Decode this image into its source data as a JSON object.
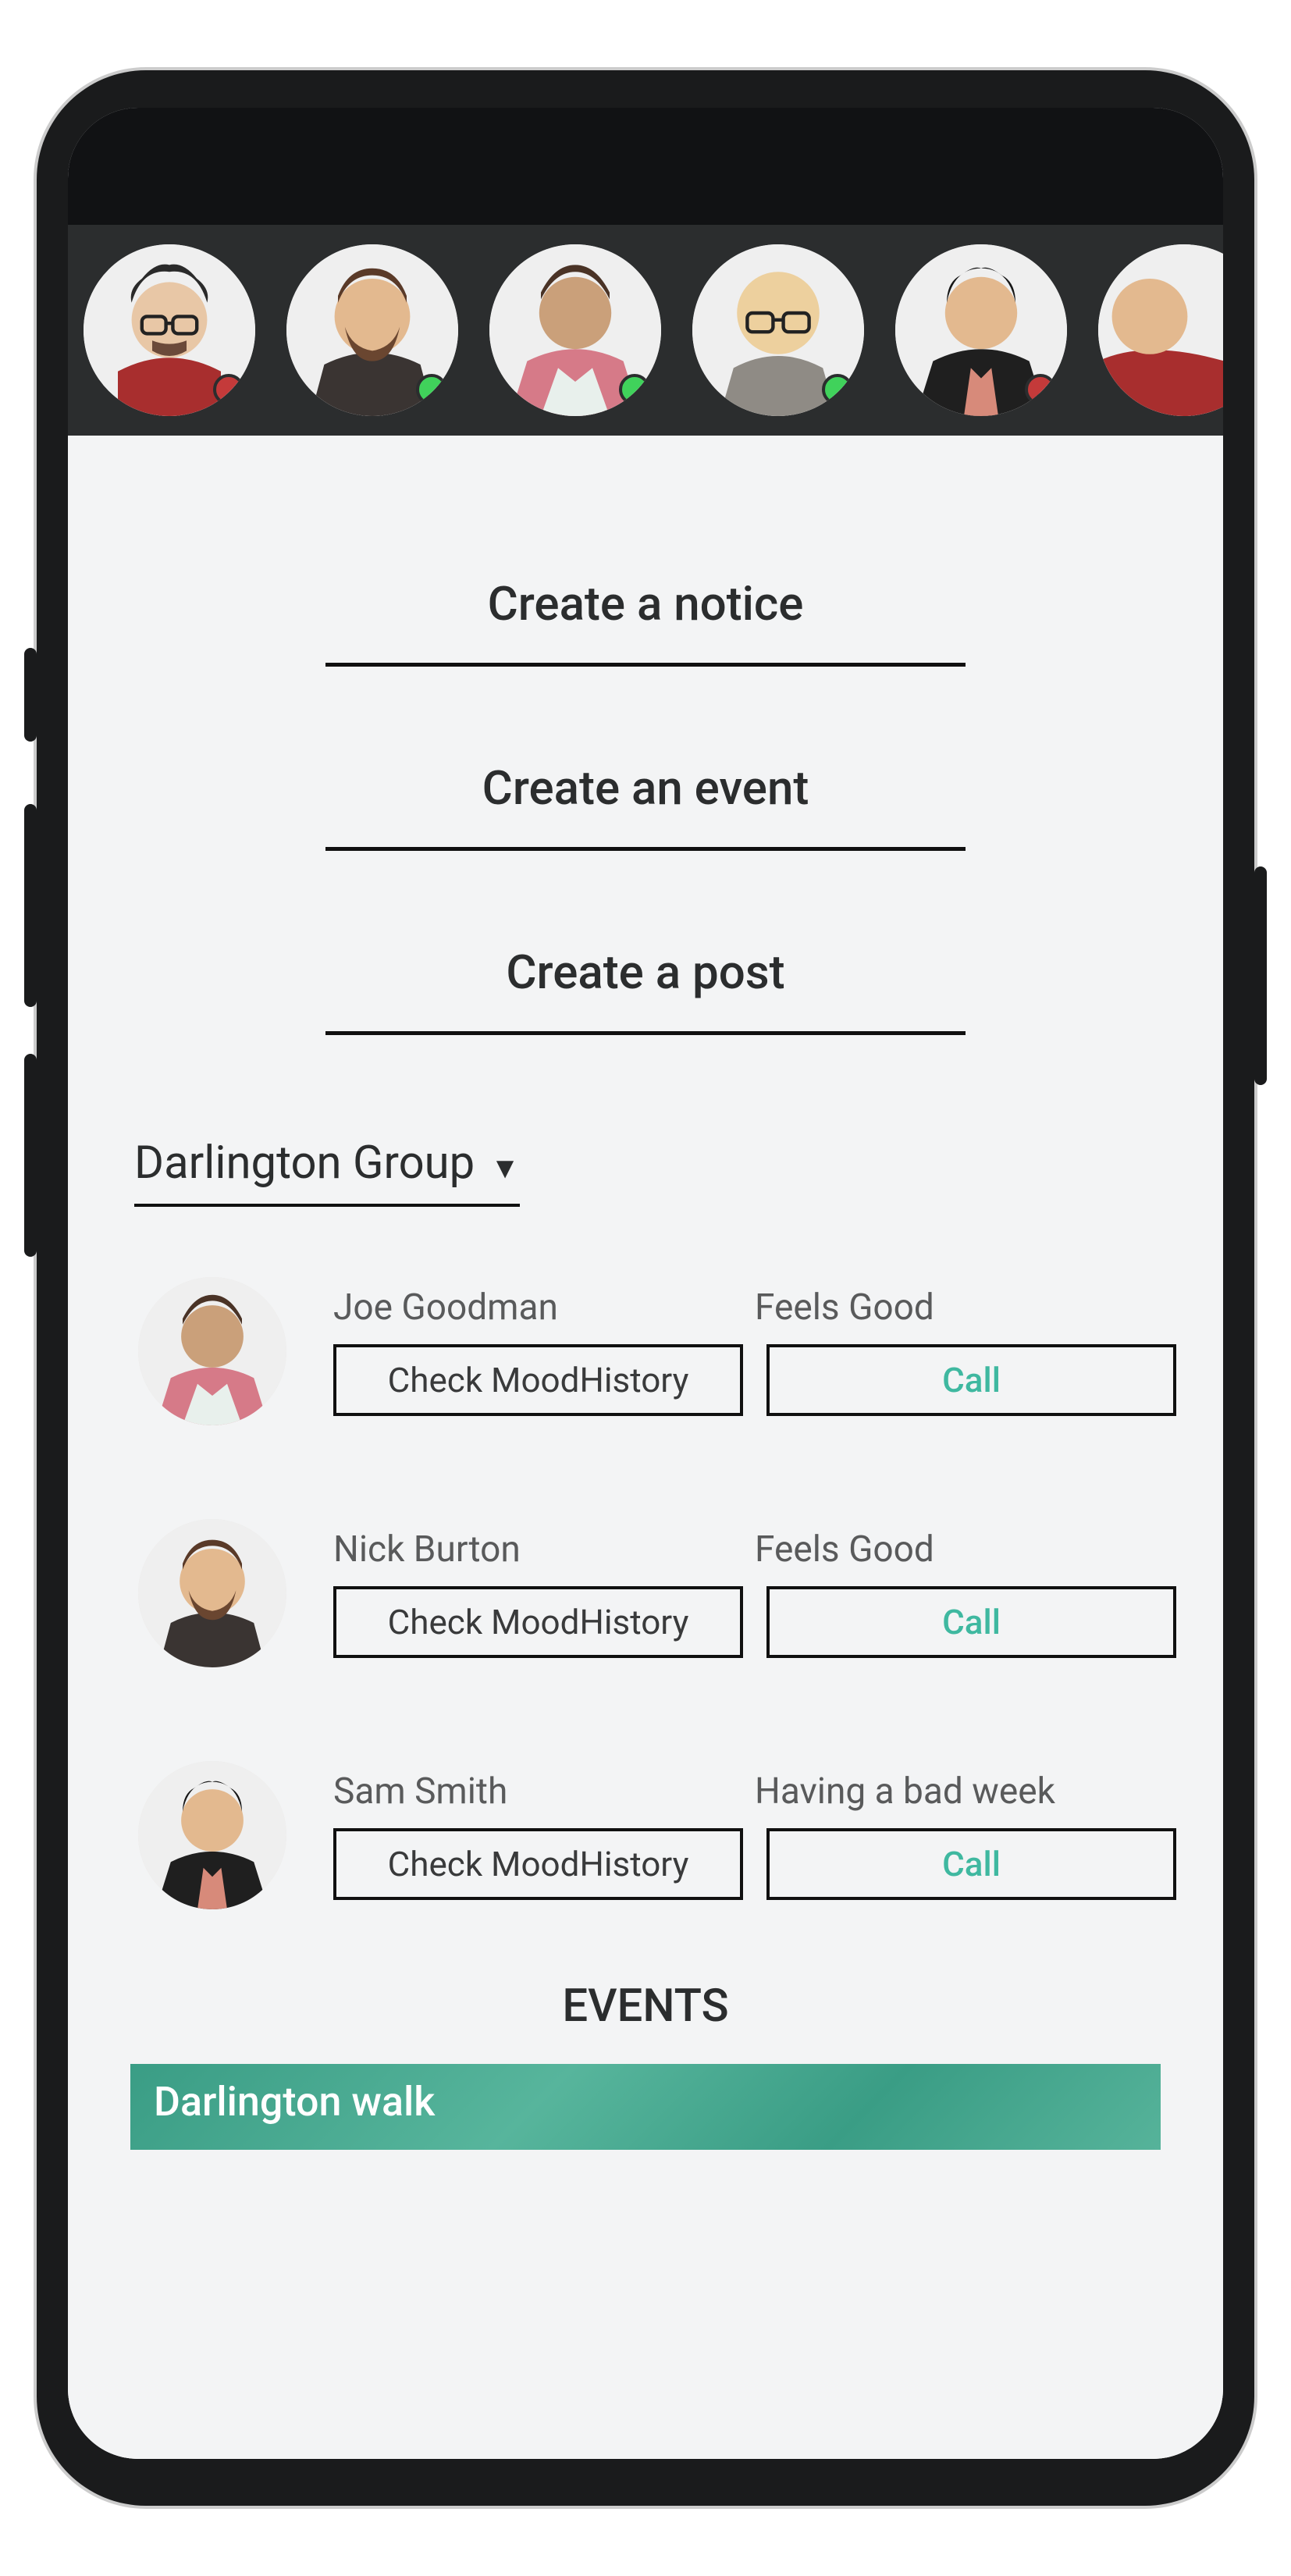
{
  "stories": [
    {
      "id": "avatar-glasses-curly",
      "presence": "offline"
    },
    {
      "id": "avatar-beard-brown",
      "presence": "online"
    },
    {
      "id": "avatar-pink-jacket",
      "presence": "online"
    },
    {
      "id": "avatar-bald-glasses",
      "presence": "online"
    },
    {
      "id": "avatar-dark-jacket",
      "presence": "offline"
    },
    {
      "id": "avatar-red-partial",
      "presence": ""
    }
  ],
  "create": {
    "notice": "Create a notice",
    "event": "Create an event",
    "post": "Create a post"
  },
  "group": {
    "selected": "Darlington Group"
  },
  "buttons": {
    "mood_history": "Check MoodHistory",
    "call": "Call"
  },
  "members": [
    {
      "name": "Joe Goodman",
      "mood": "Feels Good",
      "avatar": "avatar-pink-jacket"
    },
    {
      "name": "Nick Burton",
      "mood": "Feels Good",
      "avatar": "avatar-beard-brown"
    },
    {
      "name": "Sam Smith",
      "mood": "Having a bad week",
      "avatar": "avatar-dark-jacket"
    }
  ],
  "sections": {
    "events_title": "EVENTS"
  },
  "events": [
    {
      "title": "Darlington walk"
    }
  ],
  "colors": {
    "accent_teal": "#3fb8a0",
    "presence_online": "#40d25b",
    "presence_offline": "#c43a3a"
  }
}
